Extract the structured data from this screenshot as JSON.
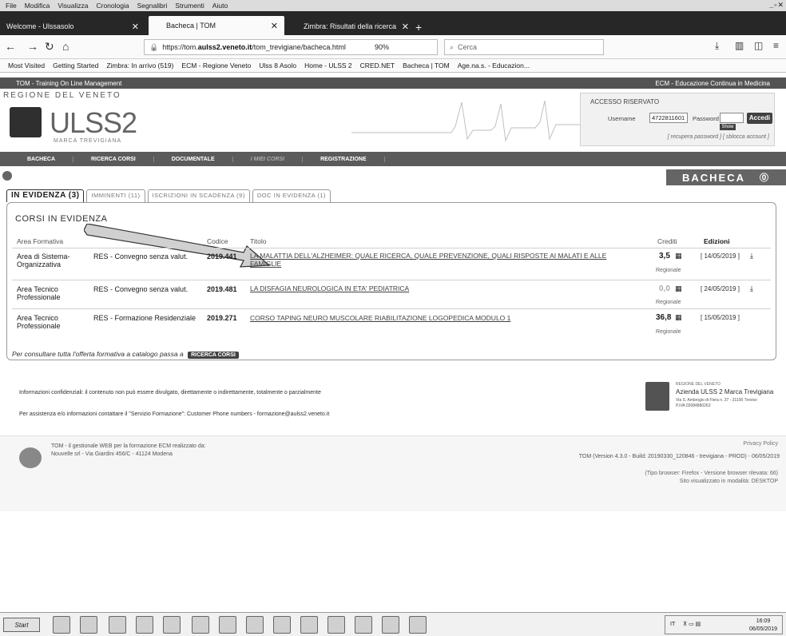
{
  "menu": [
    "File",
    "Modifica",
    "Visualizza",
    "Cronologia",
    "Segnalibri",
    "Strumenti",
    "Aiuto"
  ],
  "tabs": [
    {
      "label": "Welcome - Ulssasolo"
    },
    {
      "label": "Bacheca | TOM"
    },
    {
      "label": "Zimbra: Risultati della ricerca"
    }
  ],
  "address": {
    "url_prefix": "https://tom.",
    "url_host": "aulss2.veneto.it",
    "url_path": "/tom_trevigiane/bacheca.html",
    "zoom": "90%",
    "search_placeholder": "Cerca"
  },
  "bookmarks": [
    "Most Visited",
    "Getting Started",
    "Zimbra: In arrivo (519)",
    "ECM - Regione Veneto",
    "Ulss 8 Asolo",
    "Home - ULSS 2",
    "CRED.NET",
    "Bacheca | TOM",
    "Age.na.s. - Educazion..."
  ],
  "header": {
    "left": "TOM - Training On Line Management",
    "right": "ECM - Educazione Continua in Medicina",
    "regione": "REGIONE DEL VENETO",
    "ulss": "ULSS2",
    "marca": "MARCA TREVIGIANA"
  },
  "login": {
    "title": "ACCESSO RISERVATO",
    "username_label": "Username",
    "username_value": "4722811601",
    "password_label": "Password",
    "show": "Show",
    "button": "Accedi",
    "recover": "[ recupera password ]  [ sblocca account ]"
  },
  "nav": [
    "BACHECA",
    "RICERCA CORSI",
    "DOCUMENTALE",
    "I MIEI CORSI",
    "REGISTRAZIONE"
  ],
  "page_title": "BACHECA",
  "ptabs": [
    "IN EVIDENZA (3)",
    "IMMINENTI (11)",
    "ISCRIZIONI IN SCADENZA (9)",
    "DOC IN EVIDENZA (1)"
  ],
  "panel_title": "CORSI IN EVIDENZA",
  "columns": {
    "area": "Area Formativa",
    "tipo": "Tipologia",
    "codice": "Codice",
    "titolo": "Titolo",
    "crediti": "Crediti",
    "edizioni": "Edizioni"
  },
  "rows": [
    {
      "area": "Area di Sistema-Organizzativa",
      "tipo": "RES - Convegno senza valut.",
      "codice": "2019.441",
      "titolo": "LA MALATTIA DELL'ALZHEIMER: QUALE RICERCA, QUALE PREVENZIONE, QUALI RISPOSTE AI MALATI E ALLE FAMIGLIE",
      "crediti": "3,5",
      "reg": "Regionale",
      "ed": "[ 14/05/2019 ]"
    },
    {
      "area": "Area Tecnico Professionale",
      "tipo": "RES - Convegno senza valut.",
      "codice": "2019.481",
      "titolo": "LA DISFAGIA NEUROLOGICA IN ETA' PEDIATRICA",
      "crediti": "0,0",
      "reg": "Regionale",
      "ed": "[ 24/05/2019 ]"
    },
    {
      "area": "Area Tecnico Professionale",
      "tipo": "RES - Formazione Residenziale",
      "codice": "2019.271",
      "titolo": "CORSO TAPING NEURO MUSCOLARE RIABILITAZIONE LOGOPEDICA MODULO 1",
      "crediti": "36,8",
      "reg": "Regionale",
      "ed": "[ 15/05/2019 ]"
    }
  ],
  "catalog_text": "Per consultare tutta l'offerta formativa a catalogo passa a",
  "catalog_btn": "RICERCA CORSI",
  "footer": {
    "info": "Informazioni confidenziali: il contenuto non può essere divulgato, direttamente o indirettamente, totalmente o parzialmente",
    "assist": "Per assistenza e/o informazioni contattare il \"Servizio Formazione\": Customer Phone numbers - formazione@aulss2.veneto.it",
    "reg_small": "REGIONE DEL VENETO",
    "azienda": "Azienda ULSS 2 Marca Trevigiana",
    "address": "Via S. Ambrogio di Fiera n. 37 - 31100 Treviso",
    "piva": "P.IVA 03084880263",
    "tom1": "TOM - il gestionale WEB per la formazione ECM realizzato da:",
    "tom2": "Nouvelle srl - Via Giardini 456/C - 41124 Modena",
    "privacy": "Privacy Policy",
    "version": "TOM (Version 4.3.0 - Build: 20190330_120846 - trevigiana - PROD) - 06/05/2019",
    "browser": "(Tipo browser: Firefox - Versione browser rilevata: 66)",
    "mode": "Sito visualizzato in modalità: DESKTOP"
  },
  "taskbar": {
    "start": "Start",
    "lang": "IT",
    "time": "16:09",
    "date": "06/05/2019"
  }
}
